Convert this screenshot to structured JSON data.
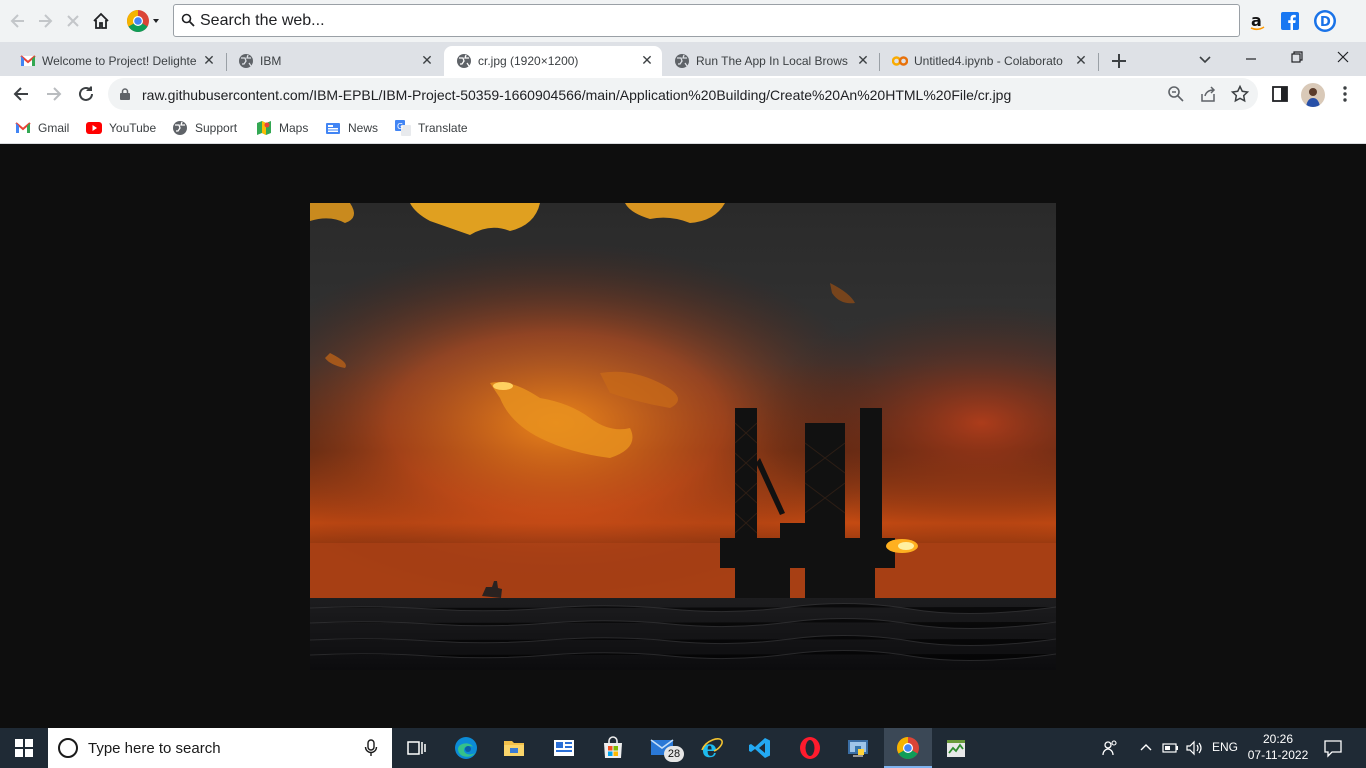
{
  "top_bar": {
    "search_text": "Search the web...",
    "icons": [
      "back-arrow-icon",
      "forward-arrow-icon",
      "stop-icon",
      "home-icon",
      "chrome-logo-icon",
      "amazon-icon",
      "facebook-icon",
      "d-profile-icon"
    ]
  },
  "tabs": [
    {
      "title": "Welcome to Project! Delighte",
      "icon": "gmail-icon"
    },
    {
      "title": "IBM",
      "icon": "globe-icon"
    },
    {
      "title": "cr.jpg (1920×1200)",
      "icon": "globe-icon",
      "active": true
    },
    {
      "title": "Run The App In Local Browse",
      "icon": "globe-icon"
    },
    {
      "title": "Untitled4.ipynb - Colaborato",
      "icon": "colab-icon"
    }
  ],
  "address_bar": {
    "url": "raw.githubusercontent.com/IBM-EPBL/IBM-Project-50359-1660904566/main/Application%20Building/Create%20An%20HTML%20File/cr.jpg"
  },
  "bookmarks": [
    {
      "label": "Gmail",
      "icon": "gmail-icon"
    },
    {
      "label": "YouTube",
      "icon": "youtube-icon"
    },
    {
      "label": "Support",
      "icon": "support-icon"
    },
    {
      "label": "Maps",
      "icon": "maps-icon"
    },
    {
      "label": "News",
      "icon": "news-icon"
    },
    {
      "label": "Translate",
      "icon": "translate-icon"
    }
  ],
  "taskbar": {
    "search_placeholder": "Type here to search",
    "mail_badge": "28",
    "language": "ENG",
    "time": "20:26",
    "date": "07-11-2022"
  },
  "colors": {
    "page_background": "#0e0e0e",
    "chrome_frame": "#dee1e6",
    "taskbar": "#1f2a35"
  }
}
